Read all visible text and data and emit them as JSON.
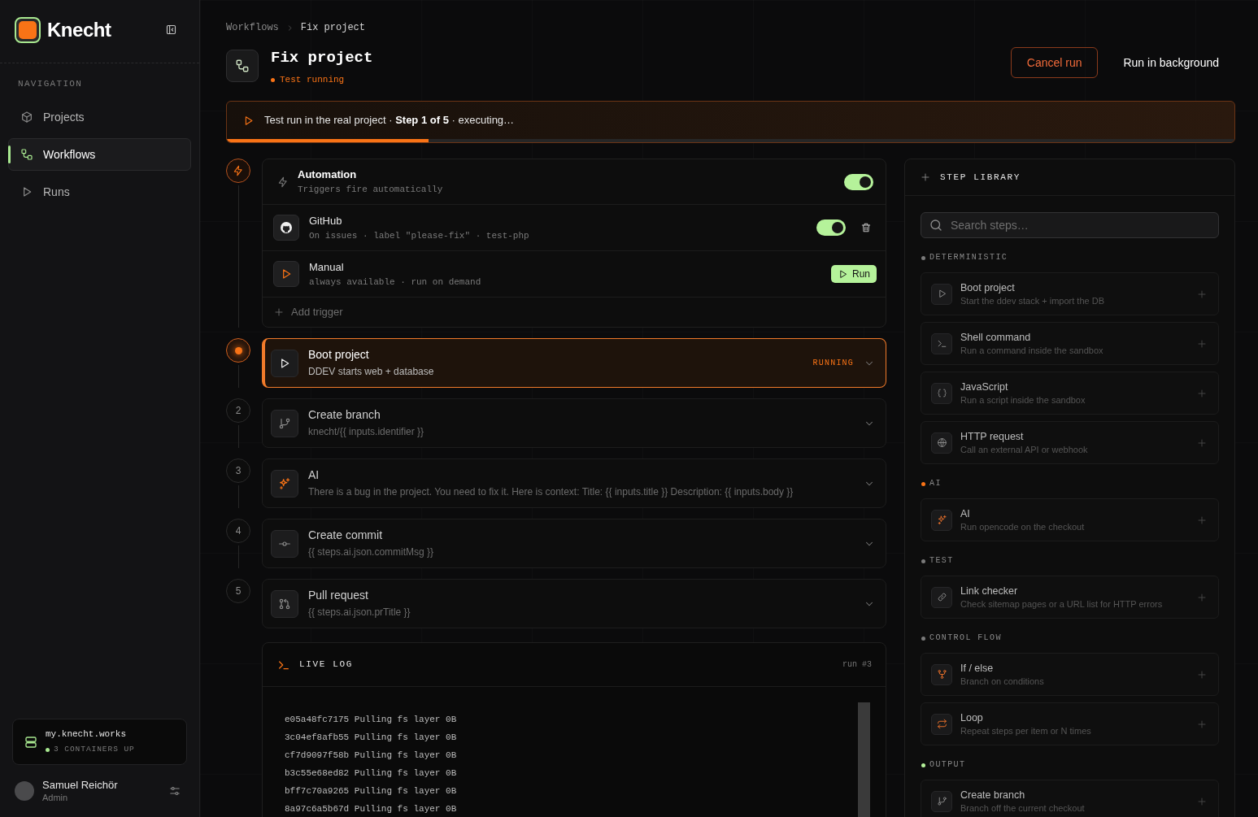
{
  "sidebar": {
    "brand": "Knecht",
    "section_label": "NAVIGATION",
    "items": [
      {
        "label": "Projects",
        "kind": "projects",
        "selected": false
      },
      {
        "label": "Workflows",
        "kind": "workflows",
        "selected": true
      },
      {
        "label": "Runs",
        "kind": "runs",
        "selected": false
      }
    ],
    "server": {
      "host": "my.knecht.works",
      "status": "3 CONTAINERS UP",
      "online": true
    },
    "user": {
      "name": "Samuel Reichör",
      "role": "Admin"
    }
  },
  "breadcrumb": [
    "Workflows",
    "Fix project"
  ],
  "header": {
    "title": "Fix project",
    "status": "Test running",
    "buttons": [
      {
        "label": "Cancel run",
        "kind": "danger"
      },
      {
        "label": "Run in background",
        "kind": "plain"
      }
    ]
  },
  "banner": {
    "text": "Test run in the real project · **Step 1 of 5** · executing…",
    "level": 0.2
  },
  "triggers": {
    "automation": {
      "title": "Automation",
      "subtitle": "Triggers fire automatically",
      "on": true
    },
    "items": [
      {
        "kind": "github",
        "title": "GitHub",
        "subtitle": "On issues · label \"please-fix\" · test-php",
        "on": true
      },
      {
        "kind": "manual",
        "title": "Manual",
        "subtitle": "always available · run on demand",
        "action": "Run"
      }
    ],
    "add_label": "Add trigger"
  },
  "steps": [
    {
      "kind": "boot",
      "title": "Boot project",
      "subtitle": "DDEV starts web + database",
      "running": true,
      "status_label": "RUNNING"
    },
    {
      "kind": "branch",
      "number": "2",
      "title": "Create branch",
      "subtitle": "knecht/{{ inputs.identifier }}",
      "running": false
    },
    {
      "kind": "ai",
      "number": "3",
      "title": "AI",
      "subtitle": "There is a bug in the project. You need to fix it. Here is context: Title: {{ inputs.title }} Description: {{ inputs.body }}",
      "running": false
    },
    {
      "kind": "commit",
      "number": "4",
      "title": "Create commit",
      "subtitle": "{{ steps.ai.json.commitMsg }}",
      "running": false
    },
    {
      "kind": "pull_request",
      "number": "5",
      "title": "Pull request",
      "subtitle": "{{ steps.ai.json.prTitle }}",
      "running": false
    }
  ],
  "live_log": {
    "title": "LIVE LOG",
    "run": "run #3",
    "lines": [
      "e05a48fc7175 Pulling fs layer 0B",
      "3c04ef8afb55 Pulling fs layer 0B",
      "cf7d9097f58b Pulling fs layer 0B",
      "b3c55e68ed82 Pulling fs layer 0B",
      "bff7c70a9265 Pulling fs layer 0B",
      "8a97c6a5b67d Pulling fs layer 0B"
    ]
  },
  "step_library": {
    "title": "STEP LIBRARY",
    "search": {
      "placeholder": "Search steps…"
    },
    "groups": [
      {
        "label": "DETERMINISTIC",
        "color": "#7a7a7a",
        "items": [
          {
            "kind": "boot",
            "title": "Boot project",
            "description": "Start the ddev stack + import the DB"
          },
          {
            "kind": "shell",
            "title": "Shell command",
            "description": "Run a command inside the sandbox"
          },
          {
            "kind": "javascript",
            "title": "JavaScript",
            "description": "Run a script inside the sandbox"
          },
          {
            "kind": "http",
            "title": "HTTP request",
            "description": "Call an external API or webhook"
          }
        ]
      },
      {
        "label": "AI",
        "color": "#f97316",
        "items": [
          {
            "kind": "ai",
            "title": "AI",
            "description": "Run opencode on the checkout"
          }
        ]
      },
      {
        "label": "TEST",
        "color": "#7a7a7a",
        "items": [
          {
            "kind": "link_checker",
            "title": "Link checker",
            "description": "Check sitemap pages or a URL list for HTTP errors"
          }
        ]
      },
      {
        "label": "CONTROL FLOW",
        "color": "#7a7a7a",
        "items": [
          {
            "kind": "if_else",
            "title": "If / else",
            "description": "Branch on conditions"
          },
          {
            "kind": "loop",
            "title": "Loop",
            "description": "Repeat steps per item or N times"
          }
        ]
      },
      {
        "label": "OUTPUT",
        "color": "#b5f29a",
        "items": [
          {
            "kind": "branch",
            "title": "Create branch",
            "description": "Branch off the current checkout"
          }
        ]
      }
    ]
  }
}
